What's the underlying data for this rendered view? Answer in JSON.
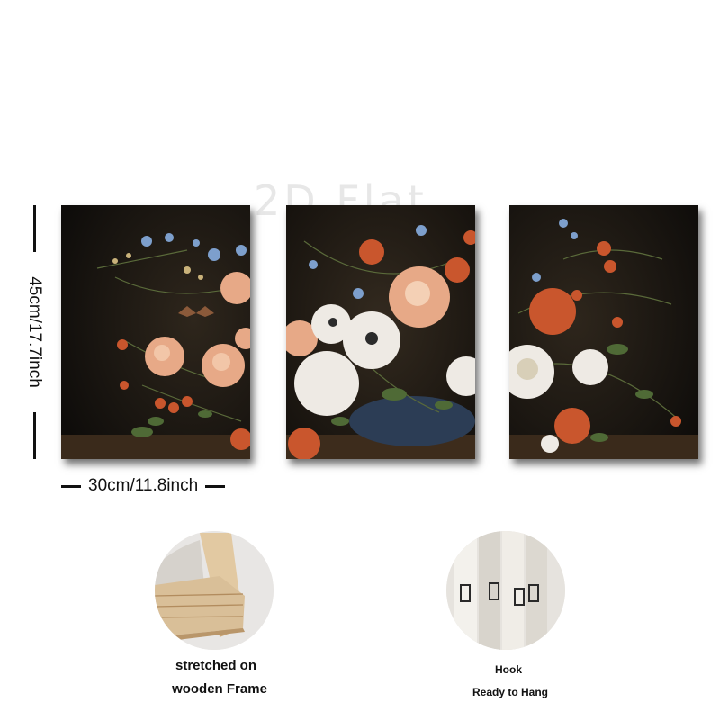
{
  "watermark": "2D Flat",
  "dimensions": {
    "height_label": "45cm/17.7inch",
    "width_label": "30cm/11.8inch"
  },
  "panels": [
    {
      "name": "left",
      "subject": "floral-painting"
    },
    {
      "name": "middle",
      "subject": "floral-painting"
    },
    {
      "name": "right",
      "subject": "floral-painting"
    }
  ],
  "features": {
    "frame": {
      "line1": "stretched on",
      "line2": "wooden Frame"
    },
    "hook": {
      "line1": "Hook",
      "line2": "Ready to Hang"
    }
  },
  "colors": {
    "background": "#ffffff",
    "painting_dark": "#1a1510",
    "peach": "#e7a987",
    "orange": "#c9562d",
    "white_flower": "#eeeae4",
    "blue_flower": "#7d9fcc",
    "wood": "#d9bf98"
  }
}
